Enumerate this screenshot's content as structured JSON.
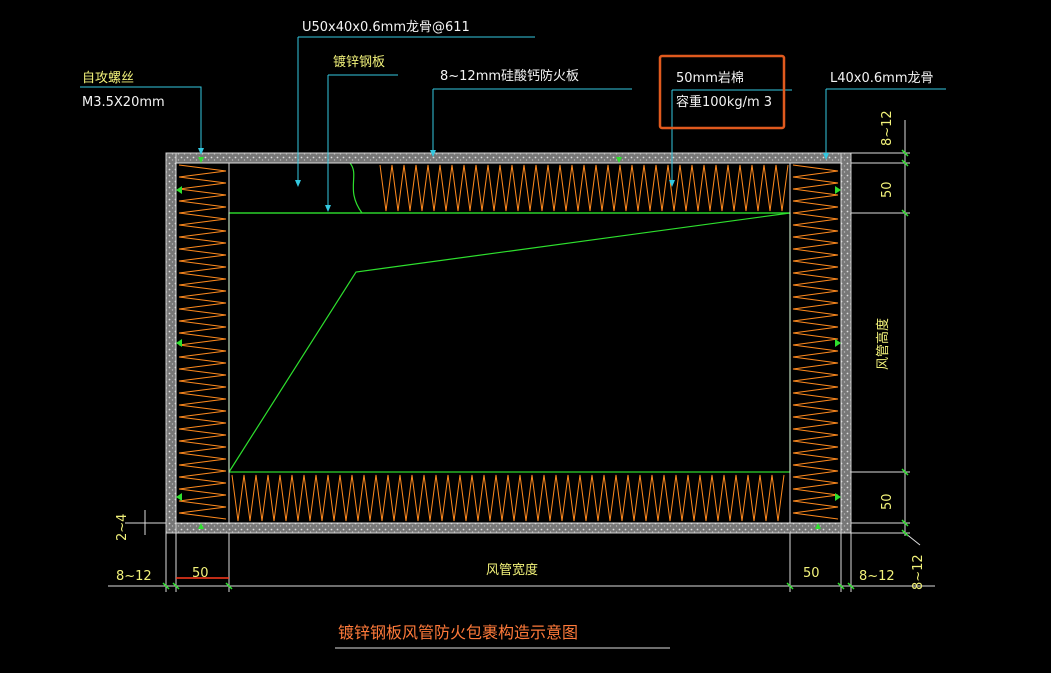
{
  "title": "镀锌钢板风管防火包裹构造示意图",
  "annotations": {
    "screw": "自攻螺丝",
    "screw_size": "M3.5X20mm",
    "keel": "U50x40x0.6mm龙骨@611",
    "steel_plate": "镀锌钢板",
    "fire_board": "8~12mm硅酸钙防火板",
    "rock_wool": "50mm岩棉",
    "density": "容重100kg/m 3",
    "angle_keel": "L40x0.6mm龙骨"
  },
  "dimensions": {
    "right_top": "8~12",
    "right_50_top": "50",
    "duct_height": "风管高度",
    "right_50_bottom": "50",
    "left_gap": "2~4",
    "bottom_left_812": "8~12",
    "bottom_left_50": "50",
    "duct_width": "风管宽度",
    "bottom_right_50": "50",
    "bottom_right_812": "8~12",
    "right_bottom_812": "8~12"
  },
  "colors": {
    "background": "#000000",
    "wool": "#ff8a1e",
    "board": "#b8b8b8",
    "leader": "#33c8e0",
    "green": "#2ee02e",
    "text": "#f2f27a",
    "highlight": "#e05a1e"
  }
}
